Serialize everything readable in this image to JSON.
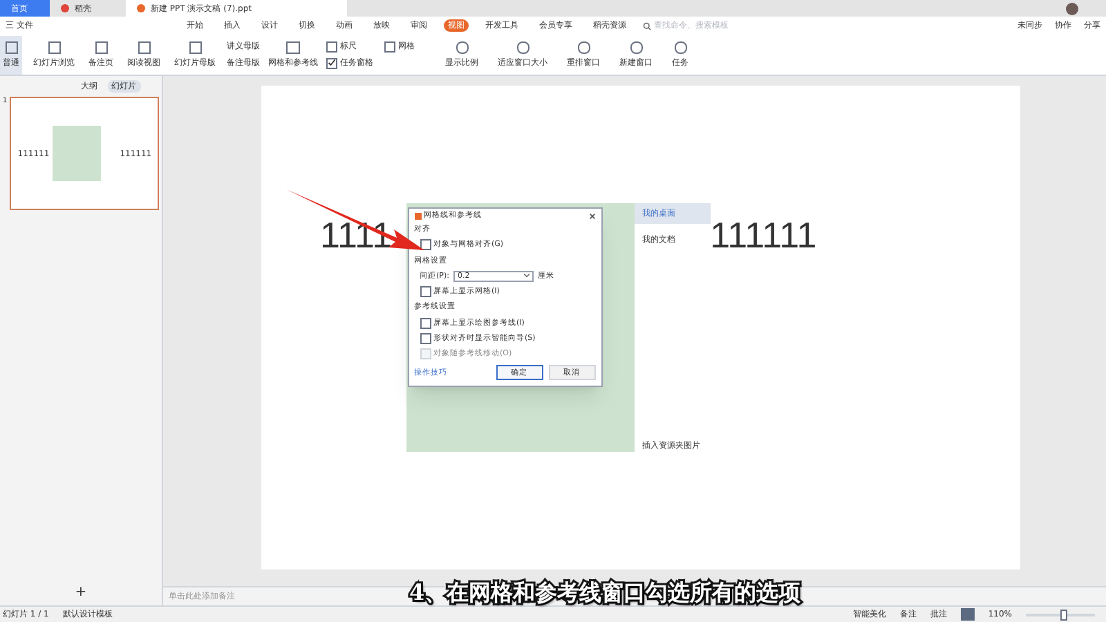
{
  "tabs": [
    {
      "label": "首页",
      "selected": true
    },
    {
      "label": "稻壳",
      "selected": false
    },
    {
      "label": "新建 PPT 演示文稿 (7).ppt",
      "selected": false
    }
  ],
  "menu": {
    "file": "三 文件",
    "items": [
      {
        "label": "开始",
        "selected": false
      },
      {
        "label": "插入",
        "selected": false
      },
      {
        "label": "设计",
        "selected": false
      },
      {
        "label": "切换",
        "selected": false
      },
      {
        "label": "动画",
        "selected": false
      },
      {
        "label": "放映",
        "selected": false
      },
      {
        "label": "审阅",
        "selected": false
      },
      {
        "label": "视图",
        "selected": true
      },
      {
        "label": "开发工具",
        "selected": false
      },
      {
        "label": "会员专享",
        "selected": false
      },
      {
        "label": "稻壳资源",
        "selected": false
      }
    ],
    "search": {
      "placeholder": "查找命令、搜索模板"
    },
    "right": [
      "未同步",
      "协作",
      "分享"
    ]
  },
  "ribbon": {
    "buttons": [
      {
        "label": "普通",
        "selected": true
      },
      {
        "label": "幻灯片浏览",
        "selected": false
      },
      {
        "label": "备注页",
        "selected": false
      },
      {
        "label": "阅读视图",
        "selected": false
      },
      {
        "label": "幻灯片母版",
        "selected": false
      }
    ],
    "masters": [
      "讲义母版",
      "备注母版"
    ],
    "grid_button": "网格和参考线",
    "checks": [
      {
        "label": "标尺",
        "checked": false
      },
      {
        "label": "网格",
        "checked": false
      },
      {
        "label": "任务窗格",
        "checked": true
      }
    ],
    "tools": [
      "显示比例",
      "适应窗口大小",
      "重排窗口",
      "新建窗口",
      "任务"
    ]
  },
  "panel": {
    "tabs": [
      {
        "label": "大纲",
        "selected": false
      },
      {
        "label": "幻灯片",
        "selected": true
      }
    ],
    "slide_number": "1",
    "thumb_text": [
      "111111",
      "111111"
    ],
    "add": "+"
  },
  "slide": {
    "left_text": "1111",
    "right_text": "111111",
    "list": [
      {
        "label": "我的桌面",
        "selected": true
      },
      {
        "label": "我的文档",
        "selected": false
      }
    ],
    "insert": "插入资源夹图片"
  },
  "dialog": {
    "title": "网格线和参考线",
    "sections": [
      {
        "heading": "对齐",
        "options": [
          {
            "kind": "check",
            "label": "对象与网格对齐(G)",
            "checked": false,
            "disabled": false
          }
        ]
      },
      {
        "heading": "网格设置",
        "options": [
          {
            "kind": "spacing",
            "label": "间距(P):",
            "value": "0.2",
            "unit": "厘米"
          },
          {
            "kind": "check",
            "label": "屏幕上显示网格(I)",
            "checked": false,
            "disabled": false
          }
        ]
      },
      {
        "heading": "参考线设置",
        "options": [
          {
            "kind": "check",
            "label": "屏幕上显示绘图参考线(I)",
            "checked": false,
            "disabled": false
          },
          {
            "kind": "check",
            "label": "形状对齐时显示智能向导(S)",
            "checked": false,
            "disabled": false
          },
          {
            "kind": "check",
            "label": "对象随参考线移动(O)",
            "checked": false,
            "disabled": true
          }
        ]
      }
    ],
    "tips": "操作技巧",
    "ok": "确定",
    "cancel": "取消"
  },
  "notes": {
    "placeholder": "单击此处添加备注"
  },
  "status_bar": {
    "slide": "幻灯片 1 / 1",
    "template": "默认设计模板",
    "beautify": "智能美化",
    "notes": "备注",
    "comments": "批注",
    "zoom": "110%",
    "level": 0.5
  },
  "caption": "4、在网格和参考线窗口勾选所有的选项"
}
